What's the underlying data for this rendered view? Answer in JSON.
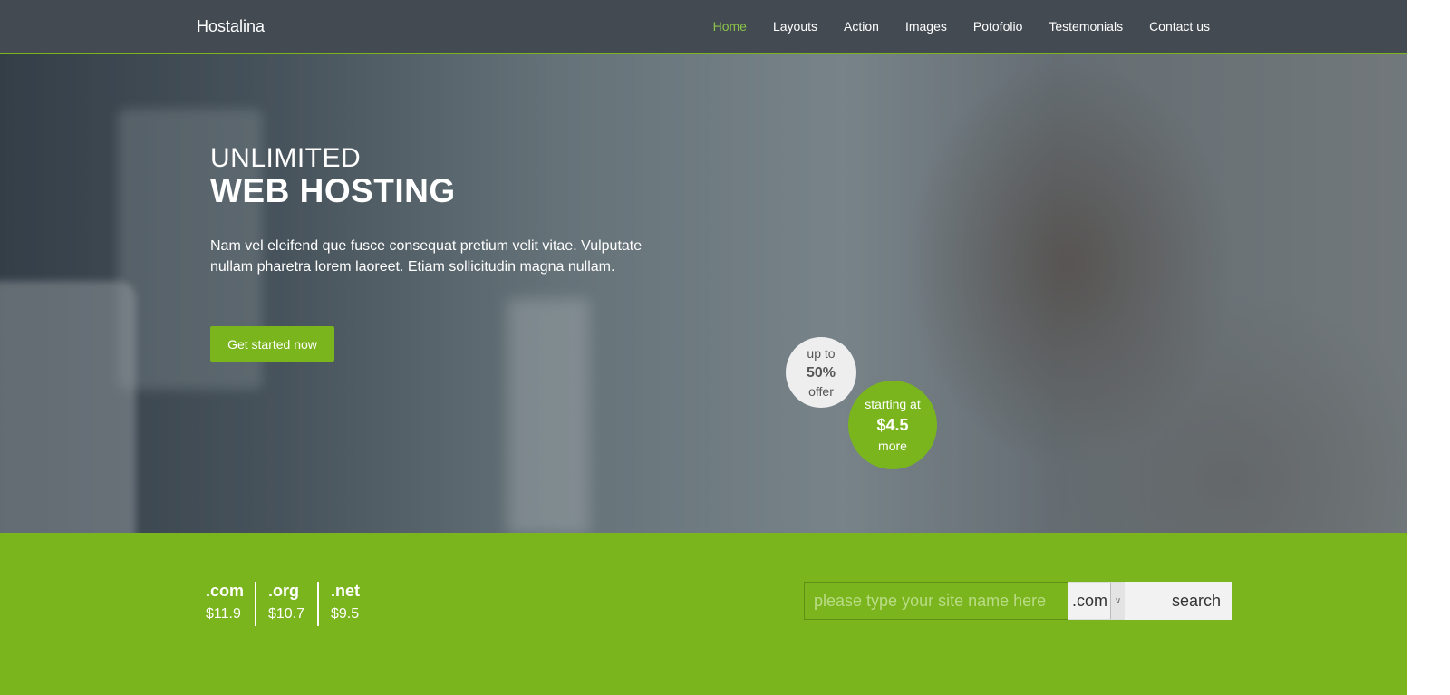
{
  "brand": "Hostalina",
  "nav": {
    "items": [
      {
        "label": "Home",
        "active": true
      },
      {
        "label": "Layouts"
      },
      {
        "label": "Action"
      },
      {
        "label": "Images"
      },
      {
        "label": "Potofolio"
      },
      {
        "label": "Testemonials"
      },
      {
        "label": "Contact us"
      }
    ]
  },
  "hero": {
    "title_line1": "UNLIMITED",
    "title_line2": "WEB HOSTING",
    "text": "Nam vel eleifend que fusce consequat pretium velit vitae. Vulputate nullam pharetra lorem laoreet. Etiam sollicitudin magna nullam.",
    "cta_label": "Get started now",
    "offer_bubble": {
      "top": "up to",
      "value": "50%",
      "bottom": "offer"
    },
    "price_bubble": {
      "top": "starting at",
      "value": "$4.5",
      "bottom": "more"
    }
  },
  "domains": [
    {
      "name": ".com",
      "price": "$11.9"
    },
    {
      "name": ".org",
      "price": "$10.7"
    },
    {
      "name": ".net",
      "price": "$9.5"
    }
  ],
  "search": {
    "placeholder": "please type your site name here",
    "tld_selected": ".com",
    "button_label": "search"
  },
  "colors": {
    "accent": "#7ab51d",
    "nav_bg": "#434a52",
    "active_link": "#8bc34a"
  }
}
